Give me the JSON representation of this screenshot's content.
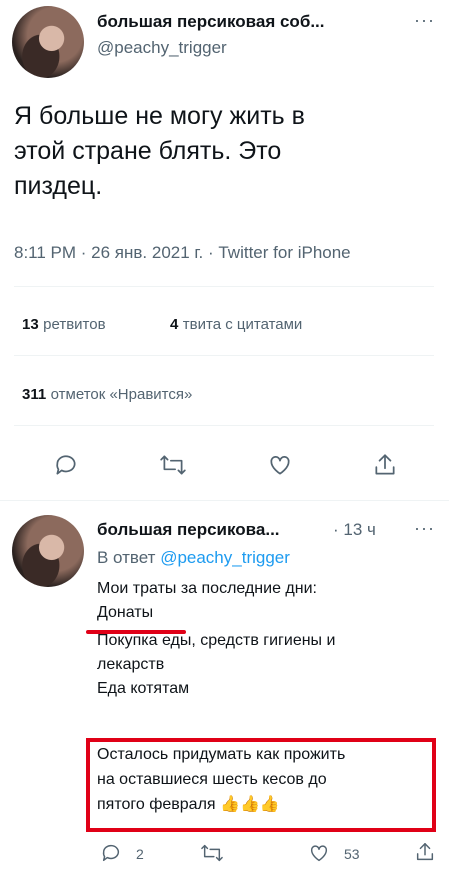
{
  "tweet": {
    "author_name": "большая персиковая соб...",
    "author_handle": "@peachy_trigger",
    "text_lines": [
      "Я больше не могу жить в",
      "этой стране блять. Это",
      "пиздец."
    ],
    "timestamp": "8:11 PM · 26 янв. 2021 г. · Twitter for iPhone",
    "retweets_count": "13",
    "retweets_label": "ретвитов",
    "quotes_count": "4",
    "quotes_label": "твита с цитатами",
    "likes_count": "311",
    "likes_label": "отметок «Нравится»",
    "more_icon": "more-icon"
  },
  "actions": [
    "reply-icon",
    "retweet-icon",
    "like-icon",
    "share-icon"
  ],
  "reply": {
    "author_name": "большая персикова...",
    "time": "· 13 ч",
    "reply_to_label": "В ответ",
    "reply_to_handle": "@peachy_trigger",
    "lines": [
      "Мои траты за последние дни:",
      "Донаты",
      "Покупка еды, средств гигиены и",
      "лекарств",
      "Еда котятам"
    ],
    "highlight_lines": [
      "Осталось придумать как прожить",
      "на оставшиеся шесть кесов до",
      "пятого февраля"
    ],
    "emoji": "👍👍👍",
    "reply_count": "2",
    "like_count": "53",
    "annotation_color": "#e00017"
  }
}
